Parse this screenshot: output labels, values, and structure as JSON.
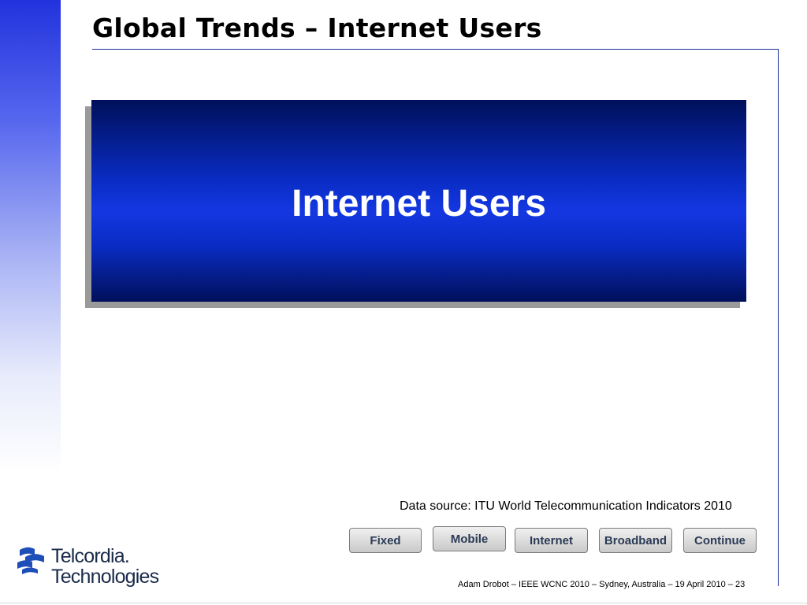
{
  "slide": {
    "title": "Global Trends – Internet Users",
    "banner_text": "Internet Users",
    "data_source": "Data source:  ITU World Telecommunication Indicators 2010",
    "footer": "Adam Drobot – IEEE WCNC 2010 – Sydney, Australia – 19 April 2010  – 23"
  },
  "nav_buttons": [
    {
      "label": "Fixed"
    },
    {
      "label": "Mobile"
    },
    {
      "label": "Internet"
    },
    {
      "label": "Broadband"
    },
    {
      "label": "Continue"
    }
  ],
  "logo": {
    "line1": "Telcordia.",
    "line2": "Technologies",
    "icon": "telcordia-logo-icon"
  },
  "colors": {
    "banner_dark": "#00105a",
    "banner_bright": "#1437e2",
    "rule": "#1a2a9a",
    "sidebar_gradient_top": "#2233dd"
  }
}
